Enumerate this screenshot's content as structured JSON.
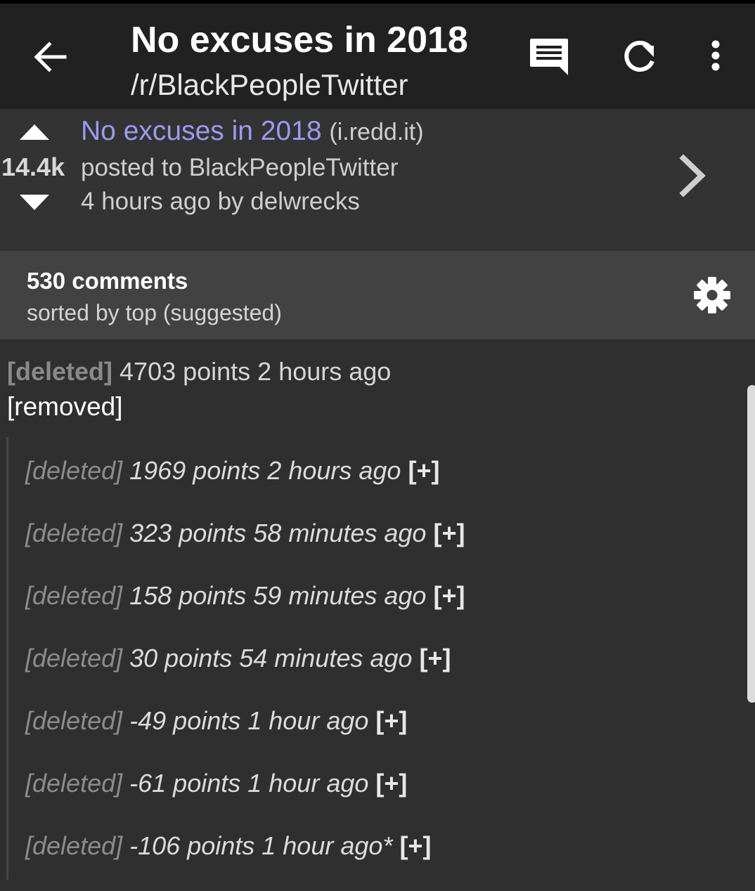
{
  "toolbar": {
    "title": "No excuses in 2018",
    "subtitle": "/r/BlackPeopleTwitter",
    "back_icon": "arrow-left-icon",
    "comment_icon": "comment-icon",
    "refresh_icon": "refresh-icon",
    "more_icon": "more-vert-icon"
  },
  "post": {
    "score": "14.4k",
    "title": "No excuses in 2018",
    "domain": "(i.redd.it)",
    "posted_to": "posted to BlackPeopleTwitter",
    "time_by": "4 hours ago by delwrecks",
    "title_color": "#9b9bf0"
  },
  "sort": {
    "count": "530 comments",
    "label": "sorted by top (suggested)"
  },
  "top_comment": {
    "author": "[deleted]",
    "meta": "4703 points 2 hours ago",
    "body": "[removed]"
  },
  "children": [
    {
      "author": "[deleted]",
      "meta": "1969 points 2 hours ago",
      "expand": "[+]"
    },
    {
      "author": "[deleted]",
      "meta": "323 points 58 minutes ago",
      "expand": "[+]"
    },
    {
      "author": "[deleted]",
      "meta": "158 points 59 minutes ago",
      "expand": "[+]"
    },
    {
      "author": "[deleted]",
      "meta": "30 points 54 minutes ago",
      "expand": "[+]"
    },
    {
      "author": "[deleted]",
      "meta": "-49 points 1 hour ago",
      "expand": "[+]"
    },
    {
      "author": "[deleted]",
      "meta": "-61 points 1 hour ago",
      "expand": "[+]"
    },
    {
      "author": "[deleted]",
      "meta": "-106 points 1 hour ago*",
      "expand": "[+]"
    }
  ]
}
